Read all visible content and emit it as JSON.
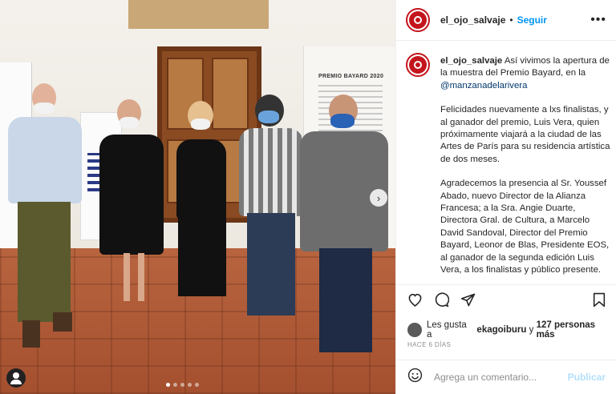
{
  "post": {
    "username": "el_ojo_salvaje",
    "separator": "•",
    "follow_label": "Seguir",
    "more_label": "•••",
    "caption": {
      "username": "el_ojo_salvaje",
      "intro": "Así vivimos la apertura de la muestra del Premio Bayard, en la",
      "mention": "@manzanadelarivera",
      "paragraph2": "Felicidades nuevamente a lxs finalistas, y al ganador del premio, Luis Vera, quien próximamente viajará a la ciudad de las Artes de París para su residencia artística de dos meses.",
      "paragraph3": "Agradecemos la presencia al Sr. Youssef Abado, nuevo Director de la Alianza Francesa; a la Sra. Angie Duarte, Directora Gral. de Cultura, a Marcelo David Sandoval, Director del Premio Bayard, Leonor de Blas, Presidente EOS, al ganador de la segunda edición Luis Vera,  a los finalistas y público presente."
    },
    "likes": {
      "prefix": "Les gusta a",
      "user": "ekagoiburu",
      "conjunction": "y",
      "count": "127 personas más"
    },
    "timestamp": "HACE 6 DÍAS",
    "comment_placeholder": "Agrega un comentario...",
    "publish_label": "Publicar"
  },
  "photo": {
    "panel_title": "PREMIO BAYARD 2020",
    "carousel_dots": 5,
    "active_dot": 0
  },
  "icons": {
    "heart": "heart-icon",
    "comment": "comment-icon",
    "share": "share-icon",
    "save": "bookmark-icon",
    "emoji": "emoji-icon",
    "next": "chevron-right-icon",
    "tag": "user-tag-icon"
  },
  "colors": {
    "accent": "#0095f6",
    "brand": "#c4151c",
    "publish_disabled": "#b2dffc"
  }
}
